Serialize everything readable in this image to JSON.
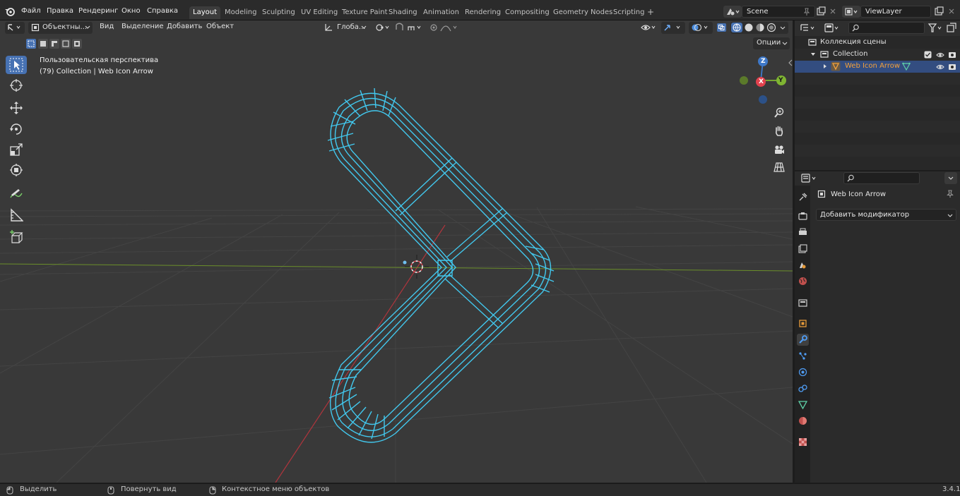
{
  "menu": {
    "items": [
      "Файл",
      "Правка",
      "Рендеринг",
      "Окно",
      "Справка"
    ]
  },
  "workspaces": {
    "tabs": [
      "Layout",
      "Modeling",
      "Sculpting",
      "UV Editing",
      "Texture Paint",
      "Shading",
      "Animation",
      "Rendering",
      "Compositing",
      "Geometry Nodes",
      "Scripting"
    ],
    "active": "Layout",
    "add": "+"
  },
  "scene": {
    "name": "Scene",
    "view_layer": "ViewLayer"
  },
  "viewport_header": {
    "mode": "Объектны...",
    "menus": [
      "Вид",
      "Выделение",
      "Добавить",
      "Объект"
    ],
    "transform_orientation": "Глоба...",
    "options": "Опции"
  },
  "viewport": {
    "view_name": "Пользовательская перспектива",
    "object_info": "(79) Collection | Web Icon Arrow",
    "gizmo": {
      "z": "Z",
      "x": "X",
      "y": "Y"
    }
  },
  "outliner": {
    "root": "Коллекция сцены",
    "collection": "Collection",
    "object": "Web Icon Arrow"
  },
  "properties": {
    "object_name": "Web Icon Arrow",
    "add_modifier": "Добавить модификатор"
  },
  "statusbar": {
    "select": "Выделить",
    "rotate": "Повернуть вид",
    "context": "Контекстное меню объектов",
    "version": "3.4.1"
  },
  "colors": {
    "accent": "#4772b3",
    "wireframe": "#42c8ee",
    "selected_object": "#f3a13b",
    "axis_x": "#e2414d",
    "axis_y": "#7fb532",
    "axis_z": "#3e78c8"
  }
}
